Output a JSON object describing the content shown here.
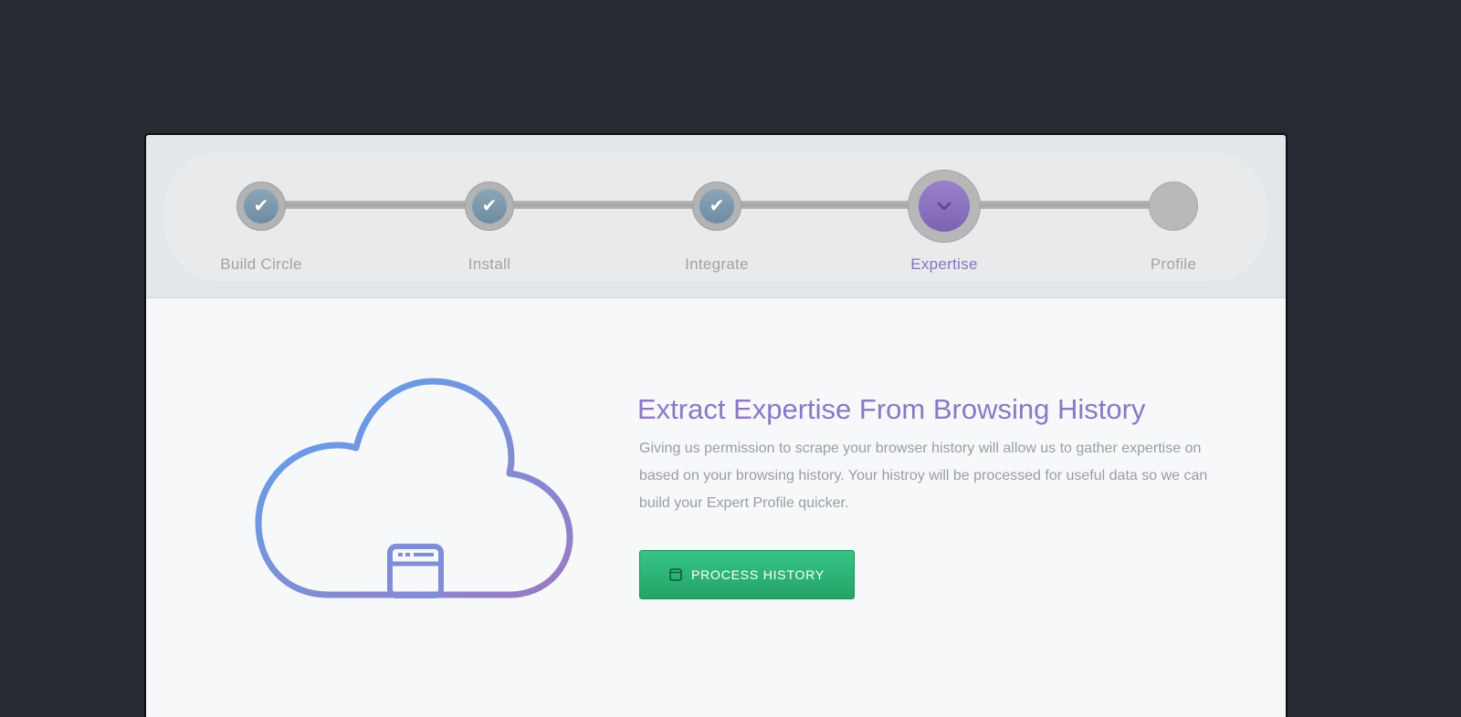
{
  "stepper": {
    "steps": [
      {
        "label": "Build Circle",
        "status": "done"
      },
      {
        "label": "Install",
        "status": "done"
      },
      {
        "label": "Integrate",
        "status": "done"
      },
      {
        "label": "Expertise",
        "status": "current"
      },
      {
        "label": "Profile",
        "status": "pending"
      }
    ]
  },
  "main": {
    "heading": "Extract Expertise From Browsing History",
    "description": "Giving us permission to scrape your browser history will allow us to gather expertise on based on your browsing history. Your histroy will be processed for useful data so we can build your Expert Profile quicker.",
    "button_label": "PROCESS HISTORY"
  },
  "icons": {
    "done_step": "check-icon",
    "current_step": "chevron-down-icon",
    "illustration": "cloud-browser-icon",
    "button": "browser-window-icon"
  },
  "colors": {
    "background": "#262a33",
    "accent_purple": "#8d77c4",
    "step_done": "#7d98ad",
    "button_green": "#2fb87b"
  }
}
